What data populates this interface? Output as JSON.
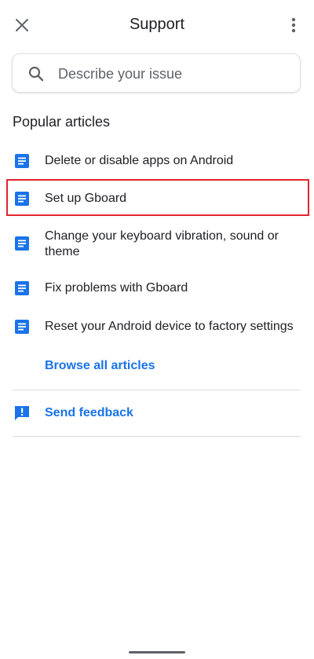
{
  "header": {
    "title": "Support",
    "close_icon": "close-icon",
    "menu_icon": "more-vert-icon"
  },
  "search": {
    "placeholder": "Describe your issue",
    "value": "",
    "icon": "search-icon"
  },
  "popular": {
    "heading": "Popular articles",
    "articles": [
      {
        "label": "Delete or disable apps on Android",
        "icon": "article-icon"
      },
      {
        "label": "Set up Gboard",
        "icon": "article-icon",
        "highlighted": true
      },
      {
        "label": "Change your keyboard vibration, sound or theme",
        "icon": "article-icon"
      },
      {
        "label": "Fix problems with Gboard",
        "icon": "article-icon"
      },
      {
        "label": "Reset your Android device to factory settings",
        "icon": "article-icon"
      }
    ],
    "browse_all_label": "Browse all articles"
  },
  "feedback": {
    "label": "Send feedback",
    "icon": "feedback-icon"
  },
  "colors": {
    "accent": "#1a73e8",
    "highlight": "#e1262e",
    "icon_gray": "#5f6368"
  }
}
